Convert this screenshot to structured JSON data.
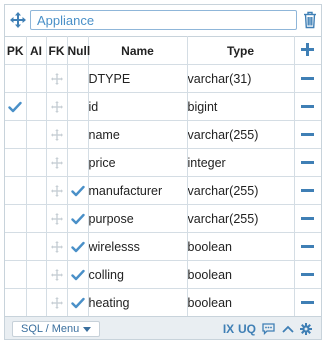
{
  "entity": {
    "name": "Appliance"
  },
  "columns_header": {
    "pk": "PK",
    "ai": "AI",
    "fk": "FK",
    "null": "Null",
    "name": "Name",
    "type": "Type"
  },
  "rows": [
    {
      "pk": false,
      "ai": false,
      "fk": false,
      "null": false,
      "name": "DTYPE",
      "type": "varchar(31)"
    },
    {
      "pk": true,
      "ai": false,
      "fk": false,
      "null": false,
      "name": "id",
      "type": "bigint"
    },
    {
      "pk": false,
      "ai": false,
      "fk": false,
      "null": false,
      "name": "name",
      "type": "varchar(255)"
    },
    {
      "pk": false,
      "ai": false,
      "fk": false,
      "null": false,
      "name": "price",
      "type": "integer"
    },
    {
      "pk": false,
      "ai": false,
      "fk": false,
      "null": true,
      "name": "manufacturer",
      "type": "varchar(255)"
    },
    {
      "pk": false,
      "ai": false,
      "fk": false,
      "null": true,
      "name": "purpose",
      "type": "varchar(255)"
    },
    {
      "pk": false,
      "ai": false,
      "fk": false,
      "null": true,
      "name": "wirelesss",
      "type": "boolean"
    },
    {
      "pk": false,
      "ai": false,
      "fk": false,
      "null": true,
      "name": "colling",
      "type": "boolean"
    },
    {
      "pk": false,
      "ai": false,
      "fk": false,
      "null": true,
      "name": "heating",
      "type": "boolean"
    }
  ],
  "footer": {
    "sql_menu_label": "SQL / Menu",
    "index_label": "IX",
    "unique_label": "UQ"
  },
  "colors": {
    "accent": "#3f7fb5",
    "check": "#4a90c8",
    "row_icon": "#c8cfd5",
    "border": "#d4dde4",
    "footer_bg": "#e9eef2"
  },
  "icons": {
    "move": "move-arrows-icon",
    "delete_entity": "trash-icon",
    "add_column": "plus-icon",
    "remove_column": "minus-icon",
    "drag_row": "drag-handle-icon",
    "check": "check-icon",
    "comment": "comment-icon",
    "collapse": "chevron-up-icon",
    "settings": "gear-icon"
  }
}
